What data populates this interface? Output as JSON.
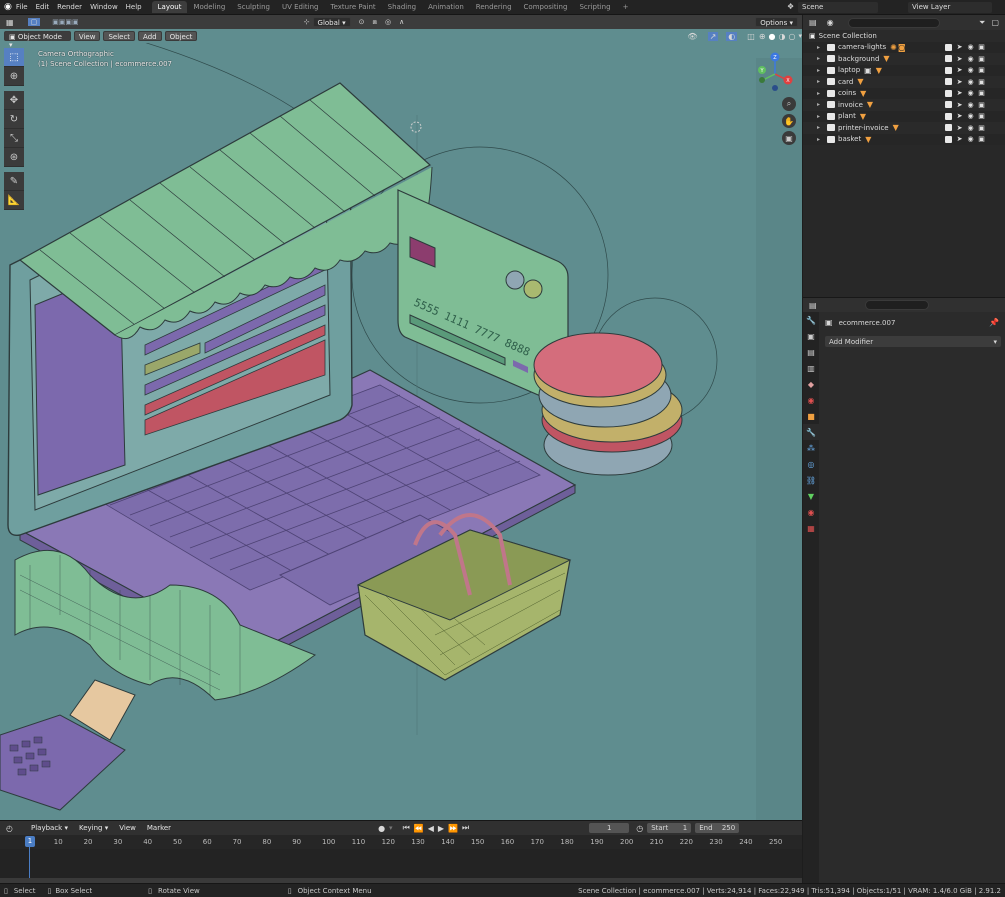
{
  "topbar": {
    "menu": [
      "File",
      "Edit",
      "Render",
      "Window",
      "Help"
    ],
    "workspaces": [
      "Layout",
      "Modeling",
      "Sculpting",
      "UV Editing",
      "Texture Paint",
      "Shading",
      "Animation",
      "Rendering",
      "Compositing",
      "Scripting"
    ],
    "active_workspace": "Layout",
    "add_workspace": "+",
    "scene_label": "Scene",
    "view_layer_label": "View Layer"
  },
  "viewport": {
    "mode": "Object Mode",
    "menus": [
      "View",
      "Select",
      "Add",
      "Object"
    ],
    "transform_orientation": "Global",
    "options_label": "Options",
    "camera_label": "Camera Orthographic",
    "collection_label": "(1) Scene Collection | ecommerce.007",
    "gizmo_axes": [
      "Z",
      "Y",
      "X"
    ],
    "bg_color": "#5f8d8f"
  },
  "outliner": {
    "root": "Scene Collection",
    "items": [
      {
        "label": "camera-lights"
      },
      {
        "label": "background"
      },
      {
        "label": "laptop"
      },
      {
        "label": "card"
      },
      {
        "label": "coins"
      },
      {
        "label": "invoice"
      },
      {
        "label": "plant"
      },
      {
        "label": "printer-invoice"
      },
      {
        "label": "basket"
      }
    ]
  },
  "properties": {
    "object_name": "ecommerce.007",
    "add_modifier": "Add Modifier"
  },
  "timeline": {
    "menus": [
      "Playback",
      "Keying",
      "View",
      "Marker"
    ],
    "current_frame": "1",
    "start_label": "Start",
    "start_value": "1",
    "end_label": "End",
    "end_value": "250",
    "ticks": [
      "1",
      "10",
      "20",
      "30",
      "40",
      "50",
      "60",
      "70",
      "80",
      "90",
      "100",
      "110",
      "120",
      "130",
      "140",
      "150",
      "160",
      "170",
      "180",
      "190",
      "200",
      "210",
      "220",
      "230",
      "240",
      "250"
    ]
  },
  "statusbar": {
    "select": "Select",
    "box_select": "Box Select",
    "rotate_view": "Rotate View",
    "context_menu": "Object Context Menu",
    "stats": "Scene Collection | ecommerce.007 | Verts:24,914 | Faces:22,949 | Tris:51,394 | Objects:1/51 | VRAM: 1.4/6.0 GiB | 2.91.2"
  }
}
